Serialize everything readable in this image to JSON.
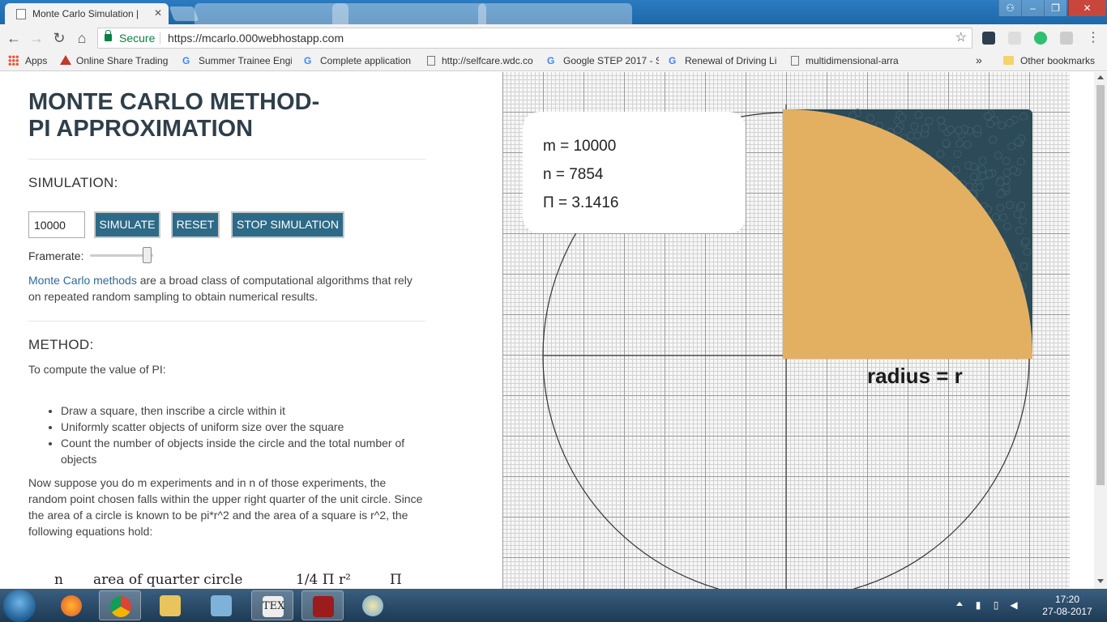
{
  "browser": {
    "active_tab": "Monte Carlo Simulation |",
    "url_secure_label": "Secure",
    "url": "https://mcarlo.000webhostapp.com",
    "bookmarks": [
      {
        "label": "Apps",
        "icon": "apps-icon"
      },
      {
        "label": "Online Share Trading",
        "icon": "share-icon"
      },
      {
        "label": "Summer Trainee Engi",
        "icon": "google-icon"
      },
      {
        "label": "Complete application",
        "icon": "google-icon"
      },
      {
        "label": "http://selfcare.wdc.co",
        "icon": "page-icon"
      },
      {
        "label": "Google STEP 2017 - S",
        "icon": "google-icon"
      },
      {
        "label": "Renewal of Driving Li",
        "icon": "google-icon"
      },
      {
        "label": "multidimensional-arra",
        "icon": "page-icon"
      },
      {
        "label": "Other bookmarks",
        "icon": "folder-icon"
      }
    ],
    "bookmarks_overflow": "»"
  },
  "page": {
    "title_line1": "MONTE CARLO METHOD-",
    "title_line2": "PI APPROXIMATION",
    "simulation_heading": "SIMULATION:",
    "input_value": "10000",
    "buttons": {
      "simulate": "SIMULATE",
      "reset": "RESET",
      "stop": "STOP SIMULATION"
    },
    "framerate_label": "Framerate:",
    "framerate_level": 0.9,
    "intro_link": "Monte Carlo methods",
    "intro_text": " are a broad class of computational algorithms that rely on repeated random sampling to obtain numerical results.",
    "method_heading": "METHOD:",
    "method_intro": "To compute the value of PI:",
    "bullets": [
      "Draw a square, then inscribe a circle within it",
      "Uniformly scatter objects of uniform size over the square",
      "Count the number of objects inside the circle and the total number of objects"
    ],
    "explanation": "Now suppose you do m experiments and in n of those experiments, the random point chosen falls within the upper right quarter of the unit circle. Since the area of a circle is known to be pi*r^2 and the area of a square is r^2, the following equations hold:",
    "formula": {
      "n": "n",
      "area": "area of quarter circle",
      "quarter": "1/4 Π r²",
      "pi": "Π"
    }
  },
  "simulation": {
    "m_text": "m = 10000",
    "n_text": "n = 7854",
    "pi_text": "Π = 3.1416",
    "radius_label": "radius = r",
    "colors": {
      "inside": "#e3b062",
      "outside": "#2c4a57",
      "dot_edge": "#3f5f6d"
    }
  },
  "taskbar": {
    "time": "17:20",
    "date": "27-08-2017"
  }
}
